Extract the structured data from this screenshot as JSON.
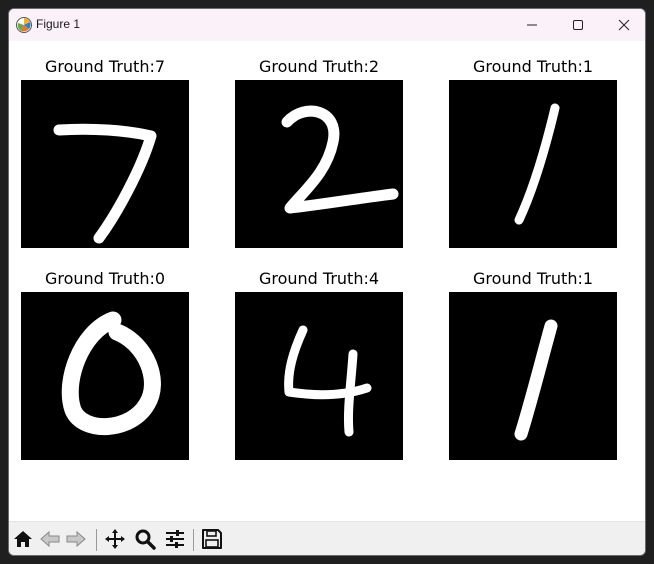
{
  "window": {
    "title": "Figure 1"
  },
  "titlebar_buttons": {
    "minimize": "minimize-icon",
    "maximize": "maximize-icon",
    "close": "close-icon"
  },
  "panels": [
    {
      "title": "Ground Truth:7",
      "digit": "7"
    },
    {
      "title": "Ground Truth:2",
      "digit": "2"
    },
    {
      "title": "Ground Truth:1",
      "digit": "1"
    },
    {
      "title": "Ground Truth:0",
      "digit": "0"
    },
    {
      "title": "Ground Truth:4",
      "digit": "4"
    },
    {
      "title": "Ground Truth:1",
      "digit": "1"
    }
  ],
  "toolbar": {
    "tools": [
      "home-icon",
      "back-arrow-icon",
      "forward-arrow-icon",
      "pan-icon",
      "zoom-icon",
      "configure-subplots-icon",
      "save-icon"
    ]
  },
  "colors": {
    "titlebar_bg": "#fbf1f8",
    "toolbar_bg": "#f0f0f0",
    "image_bg": "#000000",
    "stroke": "#ffffff"
  }
}
